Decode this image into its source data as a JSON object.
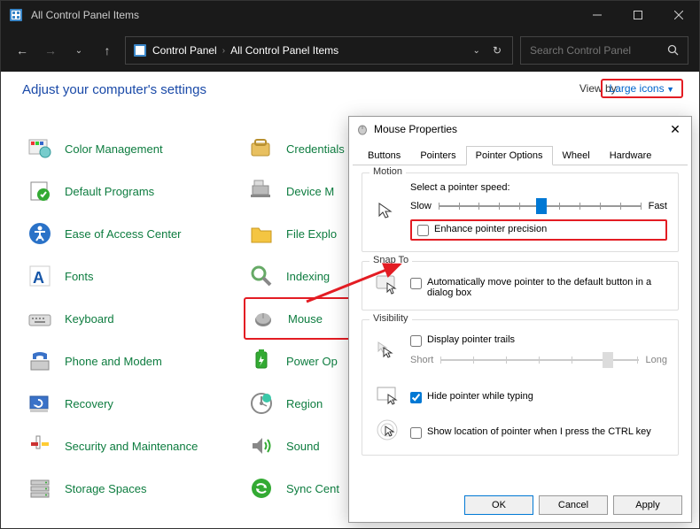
{
  "window": {
    "title": "All Control Panel Items"
  },
  "nav": {
    "crumb1": "Control Panel",
    "crumb2": "All Control Panel Items"
  },
  "search": {
    "placeholder": "Search Control Panel"
  },
  "content": {
    "heading": "Adjust your computer's settings",
    "viewby_label": "View by:",
    "viewby_value": "Large icons"
  },
  "items": {
    "col1": [
      "Color Management",
      "Default Programs",
      "Ease of Access Center",
      "Fonts",
      "Keyboard",
      "Phone and Modem",
      "Recovery",
      "Security and Maintenance",
      "Storage Spaces"
    ],
    "col2": [
      "Credentials",
      "Device M",
      "File Explo",
      "Indexing",
      "Mouse",
      "Power Op",
      "Region",
      "Sound",
      "Sync Cent"
    ]
  },
  "dialog": {
    "title": "Mouse Properties",
    "tabs": [
      "Buttons",
      "Pointers",
      "Pointer Options",
      "Wheel",
      "Hardware"
    ],
    "active_tab": "Pointer Options",
    "motion": {
      "label": "Motion",
      "speed_label": "Select a pointer speed:",
      "slow": "Slow",
      "fast": "Fast",
      "enhance": "Enhance pointer precision"
    },
    "snapto": {
      "label": "Snap To",
      "text": "Automatically move pointer to the default button in a dialog box"
    },
    "visibility": {
      "label": "Visibility",
      "trails": "Display pointer trails",
      "short": "Short",
      "long": "Long",
      "hide": "Hide pointer while typing",
      "ctrl": "Show location of pointer when I press the CTRL key"
    },
    "buttons": {
      "ok": "OK",
      "cancel": "Cancel",
      "apply": "Apply"
    }
  }
}
